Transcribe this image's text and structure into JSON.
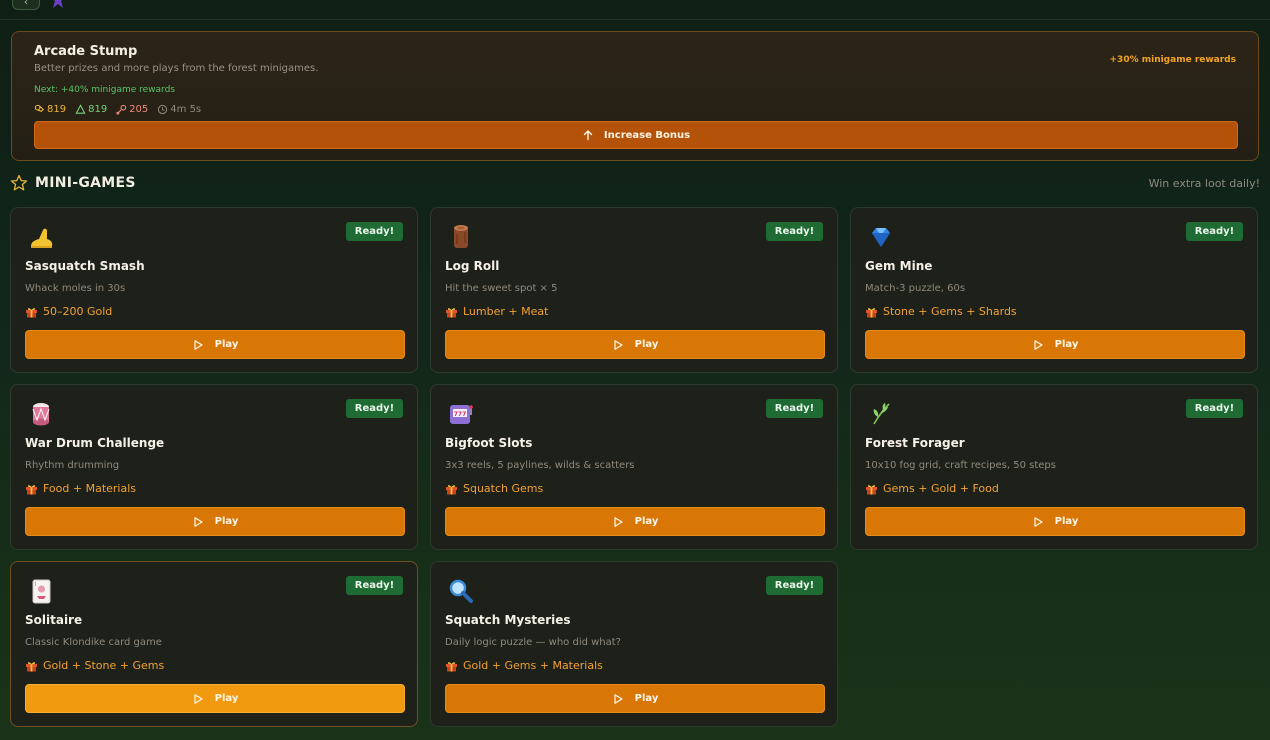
{
  "bonus": {
    "title": "Arcade Stump",
    "subtitle": "Better prizes and more plays from the forest minigames.",
    "current": "+30% minigame rewards",
    "next": "Next: +40% minigame rewards",
    "costs": {
      "lumber": "819",
      "stone": "819",
      "meat": "205",
      "time": "4m 5s"
    },
    "button_label": "Increase Bonus"
  },
  "section": {
    "title": "MINI-GAMES",
    "note": "Win extra loot daily!"
  },
  "games": [
    {
      "title": "Sasquatch Smash",
      "desc": "Whack moles in 30s",
      "reward": "50–200 Gold",
      "badge": "Ready!",
      "play": "Play",
      "icon": "sasquatch-foot-icon"
    },
    {
      "title": "Log Roll",
      "desc": "Hit the sweet spot × 5",
      "reward": "Lumber + Meat",
      "badge": "Ready!",
      "play": "Play",
      "icon": "log-icon"
    },
    {
      "title": "Gem Mine",
      "desc": "Match-3 puzzle, 60s",
      "reward": "Stone + Gems + Shards",
      "badge": "Ready!",
      "play": "Play",
      "icon": "gem-icon"
    },
    {
      "title": "War Drum Challenge",
      "desc": "Rhythm drumming",
      "reward": "Food + Materials",
      "badge": "Ready!",
      "play": "Play",
      "icon": "drum-icon"
    },
    {
      "title": "Bigfoot Slots",
      "desc": "3x3 reels, 5 paylines, wilds & scatters",
      "reward": "Squatch Gems",
      "badge": "Ready!",
      "play": "Play",
      "icon": "slot-machine-icon"
    },
    {
      "title": "Forest Forager",
      "desc": "10x10 fog grid, craft recipes, 50 steps",
      "reward": "Gems + Gold + Food",
      "badge": "Ready!",
      "play": "Play",
      "icon": "herb-icon"
    },
    {
      "title": "Solitaire",
      "desc": "Classic Klondike card game",
      "reward": "Gold + Stone + Gems",
      "badge": "Ready!",
      "play": "Play",
      "icon": "playing-card-icon"
    },
    {
      "title": "Squatch Mysteries",
      "desc": "Daily logic puzzle — who did what?",
      "reward": "Gold + Gems + Materials",
      "badge": "Ready!",
      "play": "Play",
      "icon": "magnifying-glass-icon"
    }
  ]
}
